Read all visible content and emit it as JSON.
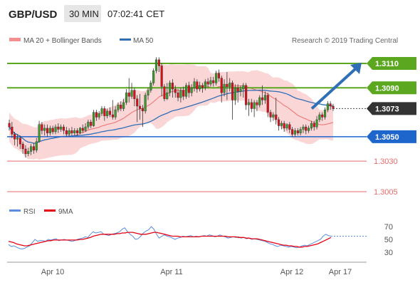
{
  "header": {
    "symbol": "GBP/USD",
    "timeframe": "30 MIN",
    "time": "07:02:41 CET"
  },
  "legend": {
    "bollinger_label": "MA 20 + Bollinger Bands",
    "ma50_label": "MA 50",
    "copyright": "Research © 2019 Trading Central"
  },
  "colors": {
    "bull": "#3a9a2c",
    "bear": "#d8101a",
    "band_fill": "#fbd6d6",
    "ma20": "#ef6f6f",
    "ma50": "#2f6fb5",
    "resistance": "#5ba820",
    "support": "#1f66cc",
    "target": "#e86a6a",
    "price_label": "#333333",
    "rsi": "#5b8ee0",
    "rsi_ma": "#e60012",
    "header_bg": "#eeeeee"
  },
  "chart_data": [
    {
      "type": "candlestick",
      "title": "GBP/USD 30 MIN",
      "x_tick_labels": [
        "Apr 10",
        "Apr 11",
        "Apr 12",
        "Apr 17"
      ],
      "ylim": [
        1.3,
        1.3125
      ],
      "series": [
        {
          "name": "MA 20 + Bollinger Bands",
          "kind": "band"
        },
        {
          "name": "MA 50",
          "kind": "line"
        }
      ],
      "price_levels": [
        {
          "label": "1.3110",
          "value": 1.311,
          "kind": "resistance"
        },
        {
          "label": "1.3090",
          "value": 1.309,
          "kind": "resistance"
        },
        {
          "label": "1.3073",
          "value": 1.3073,
          "kind": "last"
        },
        {
          "label": "1.3050",
          "value": 1.305,
          "kind": "support"
        },
        {
          "label": "1.3030",
          "value": 1.303,
          "kind": "target"
        },
        {
          "label": "1.3005",
          "value": 1.3005,
          "kind": "target"
        }
      ],
      "forecast_arrow": {
        "from": 1.3073,
        "to": 1.311
      },
      "candles": [
        [
          1.3061,
          1.3058,
          1.3064,
          1.3055
        ],
        [
          1.3058,
          1.3052,
          1.3062,
          1.3049
        ],
        [
          1.3052,
          1.3048,
          1.3054,
          1.3043
        ],
        [
          1.3048,
          1.3049,
          1.3052,
          1.3042
        ],
        [
          1.3049,
          1.3044,
          1.3051,
          1.304
        ],
        [
          1.3044,
          1.304,
          1.3046,
          1.3036
        ],
        [
          1.304,
          1.3036,
          1.3043,
          1.3033
        ],
        [
          1.3036,
          1.3038,
          1.3041,
          1.3034
        ],
        [
          1.3038,
          1.3042,
          1.3044,
          1.3035
        ],
        [
          1.3042,
          1.3039,
          1.3045,
          1.3036
        ],
        [
          1.3039,
          1.3046,
          1.3049,
          1.3037
        ],
        [
          1.3046,
          1.306,
          1.3063,
          1.3045
        ],
        [
          1.306,
          1.3055,
          1.3062,
          1.3052
        ],
        [
          1.3055,
          1.3057,
          1.306,
          1.3051
        ],
        [
          1.3057,
          1.3053,
          1.306,
          1.305
        ],
        [
          1.3053,
          1.3057,
          1.3059,
          1.3051
        ],
        [
          1.3057,
          1.3054,
          1.3059,
          1.3052
        ],
        [
          1.3054,
          1.3058,
          1.306,
          1.3052
        ],
        [
          1.3058,
          1.3056,
          1.3061,
          1.3053
        ],
        [
          1.3056,
          1.3058,
          1.306,
          1.3054
        ],
        [
          1.3058,
          1.3055,
          1.306,
          1.3052
        ],
        [
          1.3055,
          1.3052,
          1.3058,
          1.305
        ],
        [
          1.3052,
          1.3055,
          1.3057,
          1.305
        ],
        [
          1.3055,
          1.3053,
          1.3058,
          1.3051
        ],
        [
          1.3053,
          1.3055,
          1.3057,
          1.3051
        ],
        [
          1.3055,
          1.3053,
          1.3057,
          1.3051
        ],
        [
          1.3053,
          1.3057,
          1.3058,
          1.3052
        ],
        [
          1.3057,
          1.3055,
          1.306,
          1.3053
        ],
        [
          1.3055,
          1.3058,
          1.3061,
          1.3054
        ],
        [
          1.3058,
          1.3062,
          1.3064,
          1.3056
        ],
        [
          1.3062,
          1.3059,
          1.3064,
          1.3057
        ],
        [
          1.3059,
          1.307,
          1.3072,
          1.3058
        ],
        [
          1.307,
          1.3066,
          1.3072,
          1.3063
        ],
        [
          1.3066,
          1.3069,
          1.3071,
          1.3064
        ],
        [
          1.3069,
          1.3073,
          1.3075,
          1.3067
        ],
        [
          1.3073,
          1.3067,
          1.3075,
          1.3063
        ],
        [
          1.3067,
          1.3071,
          1.3073,
          1.3065
        ],
        [
          1.3071,
          1.3068,
          1.3074,
          1.3066
        ],
        [
          1.3068,
          1.3066,
          1.308,
          1.3064
        ],
        [
          1.3066,
          1.3072,
          1.3075,
          1.3064
        ],
        [
          1.3072,
          1.3076,
          1.3078,
          1.307
        ],
        [
          1.3076,
          1.3073,
          1.3079,
          1.3071
        ],
        [
          1.3073,
          1.3078,
          1.3081,
          1.3071
        ],
        [
          1.3078,
          1.3086,
          1.3089,
          1.3076
        ],
        [
          1.3086,
          1.3083,
          1.3098,
          1.3078
        ],
        [
          1.3083,
          1.3088,
          1.3094,
          1.3081
        ],
        [
          1.3088,
          1.3081,
          1.309,
          1.3075
        ],
        [
          1.3081,
          1.3075,
          1.3084,
          1.3062
        ],
        [
          1.3075,
          1.3073,
          1.3085,
          1.3064
        ],
        [
          1.3073,
          1.3071,
          1.3076,
          1.3058
        ],
        [
          1.3071,
          1.3084,
          1.3086,
          1.3069
        ],
        [
          1.3084,
          1.3088,
          1.309,
          1.308
        ],
        [
          1.3088,
          1.3094,
          1.3096,
          1.3086
        ],
        [
          1.3094,
          1.3104,
          1.3106,
          1.3092
        ],
        [
          1.3104,
          1.3113,
          1.3115,
          1.3102
        ],
        [
          1.3113,
          1.3108,
          1.3115,
          1.3103
        ],
        [
          1.3108,
          1.3091,
          1.311,
          1.3083
        ],
        [
          1.3091,
          1.3081,
          1.3093,
          1.3079
        ],
        [
          1.3081,
          1.3086,
          1.3094,
          1.308
        ],
        [
          1.3086,
          1.3094,
          1.3096,
          1.3083
        ],
        [
          1.3094,
          1.3089,
          1.3097,
          1.3082
        ],
        [
          1.3089,
          1.3086,
          1.3092,
          1.3082
        ],
        [
          1.3086,
          1.3082,
          1.3089,
          1.3079
        ],
        [
          1.3082,
          1.3088,
          1.309,
          1.3078
        ],
        [
          1.3088,
          1.3083,
          1.3091,
          1.308
        ],
        [
          1.3083,
          1.3092,
          1.3094,
          1.3081
        ],
        [
          1.3092,
          1.3086,
          1.3095,
          1.3082
        ],
        [
          1.3086,
          1.309,
          1.3093,
          1.3083
        ],
        [
          1.309,
          1.3095,
          1.3098,
          1.3087
        ],
        [
          1.3095,
          1.3089,
          1.3097,
          1.3086
        ],
        [
          1.3089,
          1.3092,
          1.3095,
          1.3087
        ],
        [
          1.3092,
          1.309,
          1.3094,
          1.3086
        ],
        [
          1.309,
          1.3095,
          1.3097,
          1.3088
        ],
        [
          1.3095,
          1.3093,
          1.3098,
          1.309
        ],
        [
          1.3093,
          1.3096,
          1.3099,
          1.3091
        ],
        [
          1.3096,
          1.3094,
          1.3099,
          1.3091
        ],
        [
          1.3094,
          1.3102,
          1.3104,
          1.3092
        ],
        [
          1.3102,
          1.3098,
          1.3105,
          1.3095
        ],
        [
          1.3098,
          1.3086,
          1.31,
          1.3078
        ],
        [
          1.3086,
          1.3093,
          1.3097,
          1.3083
        ],
        [
          1.3093,
          1.3091,
          1.3103,
          1.308
        ],
        [
          1.3091,
          1.3094,
          1.3098,
          1.3087
        ],
        [
          1.3094,
          1.308,
          1.3096,
          1.3064
        ],
        [
          1.308,
          1.309,
          1.3093,
          1.3076
        ],
        [
          1.309,
          1.3087,
          1.3093,
          1.3078
        ],
        [
          1.3087,
          1.3089,
          1.3092,
          1.3083
        ],
        [
          1.3089,
          1.3092,
          1.3094,
          1.3082
        ],
        [
          1.3092,
          1.3076,
          1.3094,
          1.3072
        ],
        [
          1.3076,
          1.3078,
          1.3081,
          1.3067
        ],
        [
          1.3078,
          1.3073,
          1.3081,
          1.307
        ],
        [
          1.3073,
          1.3078,
          1.308,
          1.3066
        ],
        [
          1.3078,
          1.3076,
          1.308,
          1.3071
        ],
        [
          1.3076,
          1.3082,
          1.3084,
          1.3074
        ],
        [
          1.3082,
          1.308,
          1.3092,
          1.3076
        ],
        [
          1.308,
          1.3084,
          1.3087,
          1.3077
        ],
        [
          1.3084,
          1.307,
          1.3086,
          1.3066
        ],
        [
          1.307,
          1.3066,
          1.3072,
          1.3062
        ],
        [
          1.3066,
          1.3068,
          1.307,
          1.3063
        ],
        [
          1.3068,
          1.3064,
          1.3082,
          1.306
        ],
        [
          1.3064,
          1.3059,
          1.3066,
          1.3055
        ],
        [
          1.3059,
          1.3061,
          1.3063,
          1.3056
        ],
        [
          1.3061,
          1.3057,
          1.3063,
          1.3054
        ],
        [
          1.3057,
          1.306,
          1.3061,
          1.3055
        ],
        [
          1.306,
          1.3056,
          1.3062,
          1.3053
        ],
        [
          1.3056,
          1.3052,
          1.3058,
          1.305
        ],
        [
          1.3052,
          1.3055,
          1.3057,
          1.305
        ],
        [
          1.3055,
          1.3053,
          1.3057,
          1.3051
        ],
        [
          1.3053,
          1.3056,
          1.3058,
          1.3051
        ],
        [
          1.3056,
          1.3058,
          1.306,
          1.3053
        ],
        [
          1.3058,
          1.3055,
          1.306,
          1.3052
        ],
        [
          1.3055,
          1.3057,
          1.3059,
          1.3053
        ],
        [
          1.3057,
          1.3061,
          1.3063,
          1.3055
        ],
        [
          1.3061,
          1.3058,
          1.3063,
          1.3055
        ],
        [
          1.3058,
          1.3064,
          1.3067,
          1.3056
        ],
        [
          1.3064,
          1.3068,
          1.307,
          1.3062
        ],
        [
          1.3068,
          1.3066,
          1.307,
          1.3063
        ],
        [
          1.3066,
          1.3072,
          1.3074,
          1.3064
        ],
        [
          1.3072,
          1.3077,
          1.3079,
          1.307
        ],
        [
          1.3077,
          1.3075,
          1.3079,
          1.3072
        ],
        [
          1.3075,
          1.3073,
          1.3077,
          1.3071
        ]
      ]
    },
    {
      "type": "line",
      "title": "RSI",
      "series": [
        {
          "name": "RSI"
        },
        {
          "name": "9MA"
        }
      ],
      "ylim": [
        20,
        80
      ],
      "y_ticks": [
        "30",
        "50",
        "70"
      ],
      "rsi_values": [
        42,
        39,
        40,
        38,
        36,
        35,
        36,
        38,
        40,
        45,
        50,
        47,
        48,
        48,
        47,
        50,
        49,
        50,
        51,
        48,
        49,
        50,
        49,
        48,
        47,
        48,
        50,
        51,
        52,
        54,
        53,
        58,
        62,
        60,
        61,
        62,
        58,
        57,
        56,
        58,
        59,
        60,
        62,
        66,
        68,
        62,
        58,
        55,
        50,
        51,
        55,
        60,
        63,
        65,
        70,
        66,
        58,
        52,
        55,
        57,
        55,
        54,
        52,
        50,
        52,
        53,
        55,
        54,
        55,
        56,
        54,
        55,
        54,
        55,
        56,
        55,
        57,
        56,
        54,
        55,
        57,
        55,
        54,
        52,
        53,
        54,
        53,
        54,
        52,
        53,
        51,
        52,
        50,
        51,
        50,
        49,
        48,
        47,
        45,
        43,
        42,
        40,
        39,
        41,
        40,
        39,
        38,
        39,
        38,
        37,
        38,
        40,
        41,
        40,
        42,
        44,
        46,
        48,
        50,
        55,
        58,
        56,
        55
      ],
      "ma_values": [
        47,
        46,
        45,
        43,
        42,
        41,
        40,
        40,
        41,
        42,
        43,
        44,
        45,
        46,
        47,
        48,
        48,
        49,
        49,
        49,
        49,
        49,
        49,
        49,
        49,
        49,
        49,
        50,
        50,
        51,
        52,
        53,
        55,
        56,
        57,
        58,
        58,
        58,
        58,
        58,
        58,
        59,
        59,
        60,
        60,
        61,
        61,
        61,
        60,
        59,
        58,
        58,
        58,
        59,
        60,
        61,
        61,
        60,
        59,
        58,
        57,
        56,
        55,
        55,
        55,
        54,
        54,
        54,
        54,
        54,
        54,
        54,
        54,
        55,
        55,
        55,
        55,
        55,
        55,
        55,
        55,
        55,
        55,
        54,
        54,
        54,
        54,
        53,
        53,
        53,
        52,
        52,
        51,
        51,
        51,
        50,
        49,
        48,
        47,
        46,
        45,
        44,
        43,
        42,
        41,
        41,
        40,
        40,
        39,
        39,
        38,
        38,
        39,
        39,
        40,
        41,
        42,
        43,
        45,
        47,
        49,
        51,
        53
      ]
    }
  ]
}
